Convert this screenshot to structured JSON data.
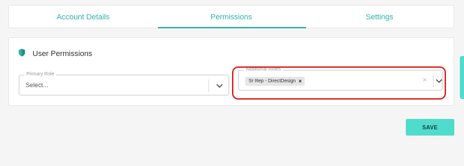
{
  "tabs": [
    {
      "label": "Account Details"
    },
    {
      "label": "Permissions"
    },
    {
      "label": "Settings"
    }
  ],
  "active_tab": "Permissions",
  "section": {
    "title": "User Permissions",
    "icon": "shield-icon"
  },
  "primary_role": {
    "label": "Primary Role",
    "placeholder": "Select..."
  },
  "additional_roles": {
    "label": "Additional Roles",
    "chips": [
      {
        "label": "Sr Rep - DirectDesign"
      }
    ]
  },
  "save_button": {
    "label": "SAVE"
  },
  "colors": {
    "accent": "#2bb3a8",
    "button": "#4fdccc",
    "highlight": "#e02020"
  }
}
